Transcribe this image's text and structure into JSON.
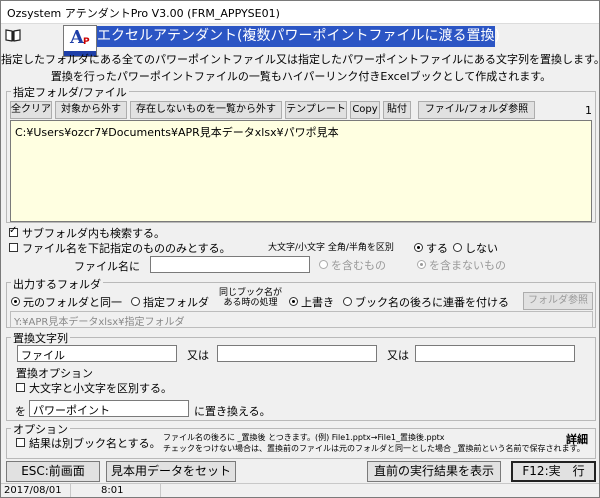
{
  "window": {
    "title": "Ozsystem アテンダントPro V3.00 (FRM_APPYSE01)"
  },
  "header": {
    "banner": "エクセルアテンダント(複数パワーポイントファイルに渡る置換)",
    "desc1": "指定したフォルダにある全てのパワーポイントファイル又は指定したパワーポイントファイルにある文字列を置換します。",
    "desc2": "置換を行ったパワーポイントファイルの一覧もハイパーリンク付きExcelブックとして作成されます。",
    "logo_letter": "A",
    "logo_sub": "P"
  },
  "folder_group": {
    "label": "指定フォルダ/ファイル",
    "buttons": [
      "全クリア",
      "対象から外す",
      "存在しないものを一覧から外す",
      "テンプレート",
      "Copy",
      "貼付",
      "ファイル/フォルダ参照"
    ],
    "count": "1",
    "items": [
      "C:¥Users¥ozcr7¥Documents¥APR見本データxlsx¥パワポ見本"
    ]
  },
  "options": {
    "subfolder": {
      "label": "サブフォルダ内も検索する。",
      "checked": true
    },
    "filename_only": {
      "label": "ファイル名を下記指定のもののみとする。",
      "checked": false
    },
    "case_label": "大文字/小文字 全角/半角を区別",
    "case_yes": "する",
    "case_no": "しない",
    "filename_label": "ファイル名に",
    "filename_value": "",
    "include": "を含むもの",
    "exclude": "を含まないもの"
  },
  "output": {
    "label": "出力するフォルダ",
    "same": "元のフォルダと同一",
    "specified": "指定フォルダ",
    "same_name_label": "同じブック名が\nある時の処理",
    "overwrite": "上書き",
    "serial": "ブック名の後ろに連番を付ける",
    "browse": "フォルダ参照",
    "path": "Y:¥APR見本データxlsx¥指定フォルダ"
  },
  "replace": {
    "label": "置換文字列",
    "find1": "ファイル",
    "or1": "又は",
    "find2": "",
    "or2": "又は",
    "find3": "",
    "option_label": "置換オプション",
    "case_sensitive": "大文字と小文字を区別する。",
    "to_label": "を",
    "to_value": "パワーポイント",
    "to_suffix": "に置き換える。"
  },
  "option_group": {
    "label": "オプション",
    "separate_book": "結果は別ブック名とする。",
    "note1": "ファイル名の後ろに _置換後 とつきます。(例) File1.pptx→File1_置換後.pptx",
    "note2": "チェックをつけない場合は、置換前のファイルは元のフォルダと同一とした場合 _置換前という名前で保存されます。",
    "detail": "詳細"
  },
  "footer": {
    "esc": "ESC:前画面",
    "sample": "見本用データをセット",
    "last_result": "直前の実行結果を表示",
    "run": "F12:実　行"
  },
  "status": {
    "date": "2017/08/01",
    "time": "8:01"
  }
}
